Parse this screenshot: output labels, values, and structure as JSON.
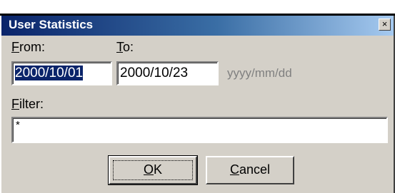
{
  "window": {
    "title": "User Statistics",
    "close_glyph": "×"
  },
  "from": {
    "label_access": "F",
    "label_rest": "rom:",
    "value": "2000/10/01"
  },
  "to": {
    "label_access": "T",
    "label_rest": "o:",
    "value": "2000/10/23"
  },
  "date_format_hint": "yyyy/mm/dd",
  "filter": {
    "label_access": "F",
    "label_rest": "ilter:",
    "value": "*"
  },
  "buttons": {
    "ok_access": "O",
    "ok_rest": "K",
    "cancel_access": "C",
    "cancel_rest": "ancel"
  }
}
